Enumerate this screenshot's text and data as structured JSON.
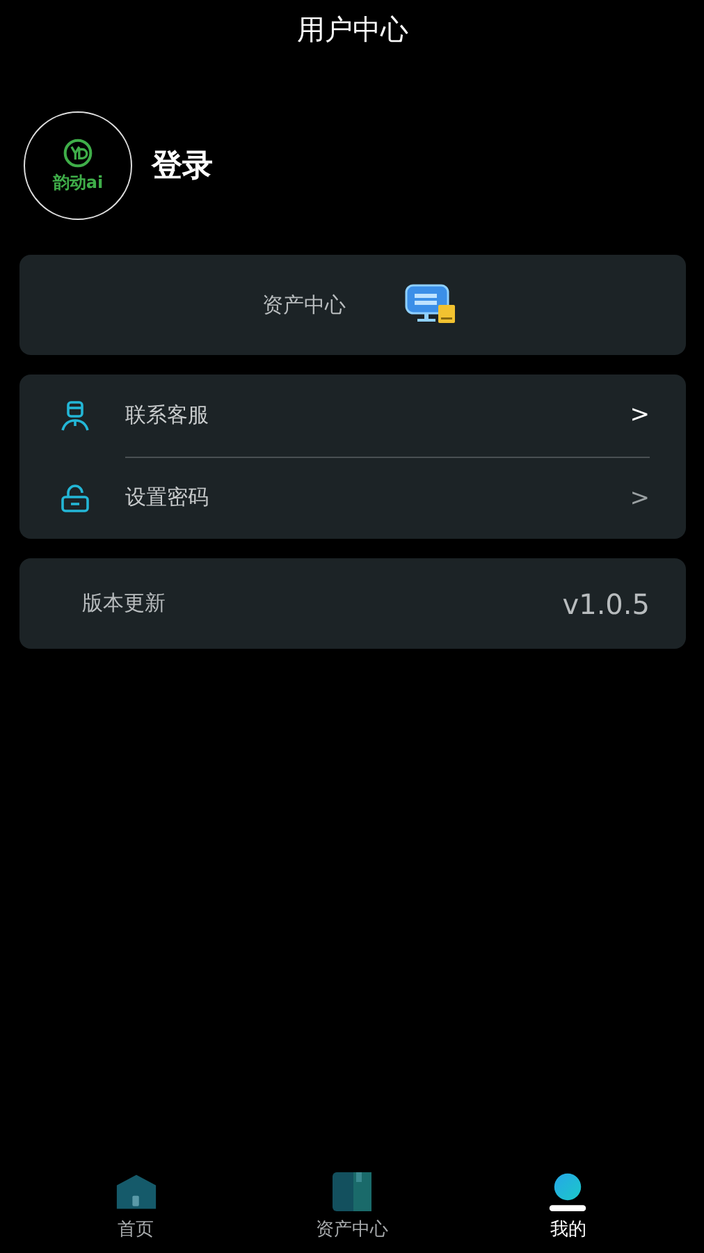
{
  "header": {
    "title": "用户中心"
  },
  "profile": {
    "logo_text": "韵动ai",
    "login": "登录"
  },
  "asset_card": {
    "label": "资产中心"
  },
  "menu": [
    {
      "kind": "service",
      "label": "联系客服",
      "chevron": ">"
    },
    {
      "kind": "lock",
      "label": "设置密码",
      "chevron": ">"
    }
  ],
  "version": {
    "label": "版本更新",
    "value": "v1.0.5"
  },
  "tabs": [
    {
      "kind": "home",
      "label": "首页",
      "selected": false
    },
    {
      "kind": "assets",
      "label": "资产中心",
      "selected": false
    },
    {
      "kind": "me",
      "label": "我的",
      "selected": true
    }
  ]
}
